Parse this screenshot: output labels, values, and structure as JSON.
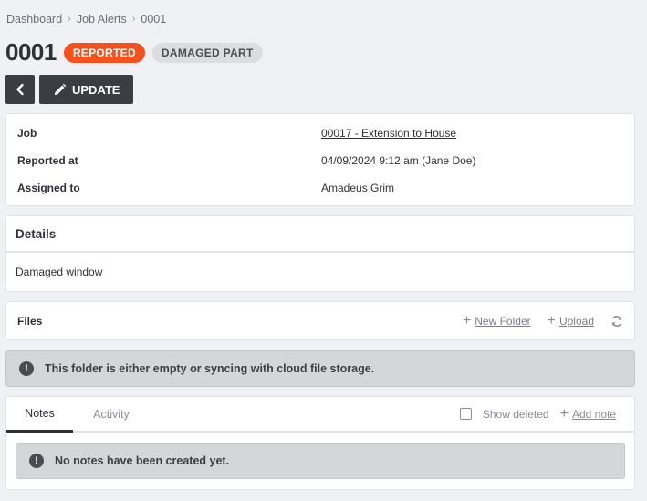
{
  "breadcrumb": [
    "Dashboard",
    "Job Alerts",
    "0001"
  ],
  "title": "0001",
  "badges": {
    "status": "REPORTED",
    "category": "DAMAGED PART"
  },
  "actions": {
    "update_label": "UPDATE"
  },
  "info": {
    "job_label": "Job",
    "job_value": "00017 - Extension to House",
    "reported_label": "Reported at",
    "reported_value": "04/09/2024 9:12 am (Jane Doe)",
    "assigned_label": "Assigned to",
    "assigned_value": "Amadeus Grim"
  },
  "details": {
    "heading": "Details",
    "body": "Damaged window"
  },
  "files": {
    "title": "Files",
    "new_folder": "New Folder",
    "upload": "Upload",
    "empty_message": "This folder is either empty or syncing with cloud file storage."
  },
  "notes": {
    "tabs": [
      "Notes",
      "Activity"
    ],
    "show_deleted": "Show deleted",
    "add_note": "Add note",
    "empty_message": "No notes have been created yet."
  },
  "colors": {
    "accent": "#f4511e",
    "dark": "#3b3d42",
    "background": "#f0f1f4"
  },
  "icons": [
    "chevron-right-icon",
    "chevron-left-icon",
    "pencil-icon",
    "plus-icon",
    "refresh-icon",
    "exclamation-icon",
    "checkbox-icon"
  ]
}
